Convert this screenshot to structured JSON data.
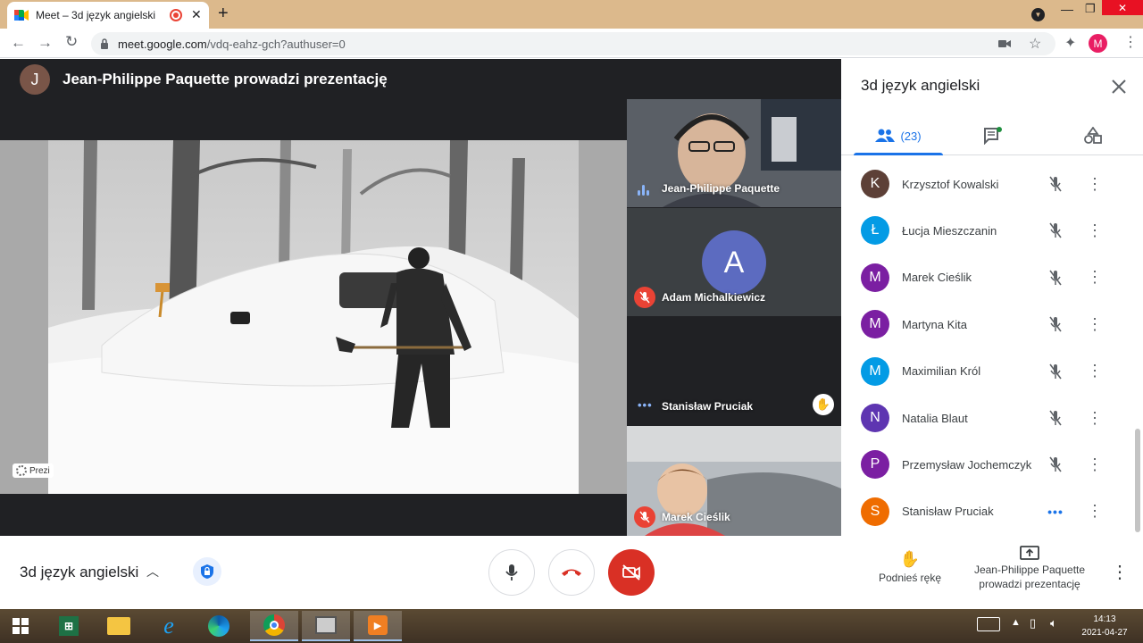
{
  "browser": {
    "tab_title": "Meet – 3d język angielski",
    "url_host": "meet.google.com",
    "url_path": "/vdq-eahz-gch?authuser=0",
    "profile_initial": "M",
    "tabstrip_color": "#dcb98c"
  },
  "presenter": {
    "avatar_initial": "J",
    "title": "Jean-Philippe Paquette prowadzi prezentację"
  },
  "slide": {
    "badge": "Prezi"
  },
  "tiles": [
    {
      "name": "Jean-Philippe Paquette",
      "status": "speaking"
    },
    {
      "name": "Adam Michalkiewicz",
      "avatar_initial": "A",
      "avatar_color": "#5c6bc0",
      "status": "muted"
    },
    {
      "name": "Stanisław Pruciak",
      "status": "hand-raised"
    },
    {
      "name": "Marek Cieślik",
      "status": "muted"
    }
  ],
  "panel": {
    "title": "3d język angielski",
    "people_count": "(23)",
    "people": [
      {
        "name": "Krzysztof Kowalski",
        "initial": "K",
        "color": "#5d4037",
        "status": "muted"
      },
      {
        "name": "Łucja Mieszczanin",
        "initial": "Ł",
        "color": "#039be5",
        "status": "muted"
      },
      {
        "name": "Marek Cieślik",
        "initial": "M",
        "color": "#7b1fa2",
        "status": "muted"
      },
      {
        "name": "Martyna Kita",
        "initial": "M",
        "color": "#7b1fa2",
        "status": "muted"
      },
      {
        "name": "Maximilian Król",
        "initial": "M",
        "color": "#039be5",
        "status": "muted"
      },
      {
        "name": "Natalia Blaut",
        "initial": "N",
        "color": "#5e35b1",
        "status": "muted"
      },
      {
        "name": "Przemysław Jochemczyk",
        "initial": "P",
        "color": "#7b1fa2",
        "status": "muted"
      },
      {
        "name": "Stanisław Pruciak",
        "initial": "S",
        "color": "#ef6c00",
        "status": "speaking"
      }
    ]
  },
  "controls": {
    "meeting_name": "3d język angielski",
    "raise_hand_label": "Podnieś rękę",
    "present_label_line1": "Jean-Philippe Paquette",
    "present_label_line2": "prowadzi prezentację"
  },
  "taskbar": {
    "time": "14:13",
    "date": "2021-04-27"
  }
}
